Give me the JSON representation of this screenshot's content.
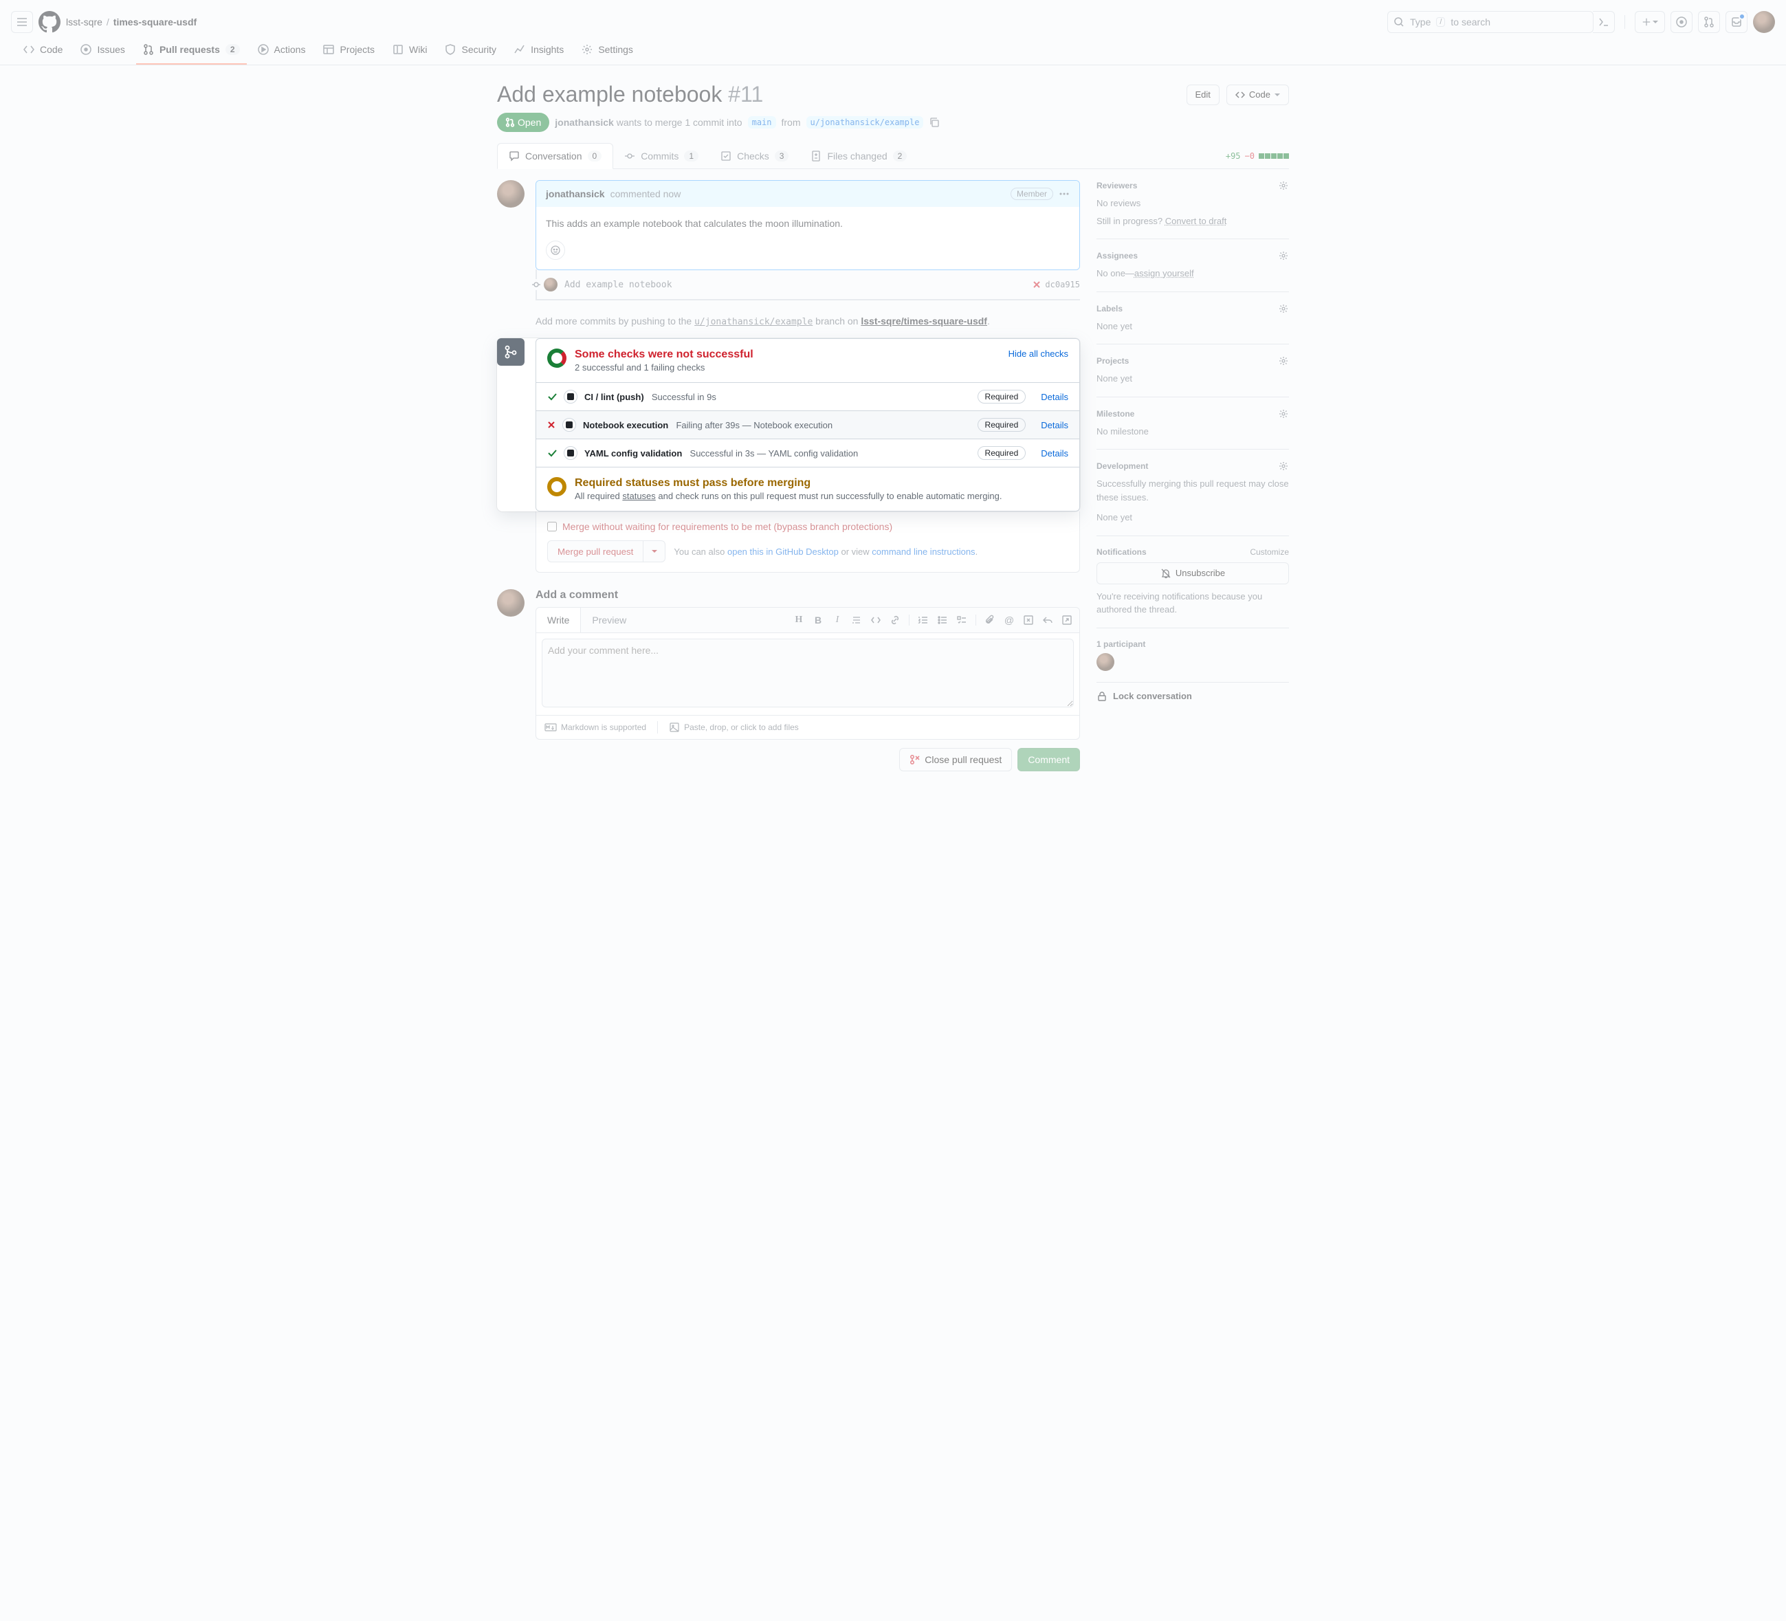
{
  "breadcrumb": {
    "owner": "lsst-sqre",
    "repo": "times-square-usdf"
  },
  "search": {
    "pre": "Type ",
    "post": " to search",
    "key": "/"
  },
  "reponav": {
    "code": "Code",
    "issues": "Issues",
    "pulls": "Pull requests",
    "pulls_count": "2",
    "actions": "Actions",
    "projects": "Projects",
    "wiki": "Wiki",
    "security": "Security",
    "insights": "Insights",
    "settings": "Settings"
  },
  "pr": {
    "title": "Add example notebook",
    "number": "#11",
    "edit": "Edit",
    "code": "Code",
    "state": "Open",
    "author": "jonathansick",
    "sub1": "wants to merge 1 commit into",
    "base": "main",
    "sub2": "from",
    "head": "u/jonathansick/example",
    "diff_add": "+95",
    "diff_del": "−0"
  },
  "tabs": {
    "conv": "Conversation",
    "conv_n": "0",
    "commits": "Commits",
    "commits_n": "1",
    "checks": "Checks",
    "checks_n": "3",
    "files": "Files changed",
    "files_n": "2"
  },
  "comment": {
    "author": "jonathansick",
    "meta": "commented now",
    "badge": "Member",
    "body": "This adds an example notebook that calculates the moon illumination."
  },
  "commit": {
    "msg": "Add example notebook",
    "sha": "dc0a915"
  },
  "push_hint": {
    "pre": "Add more commits by pushing to the ",
    "branch": "u/jonathansick/example",
    "mid": " branch on ",
    "repo": "lsst-sqre/times-square-usdf",
    "end": "."
  },
  "checks": {
    "hdr": "Some checks were not successful",
    "sub": "2 successful and 1 failing checks",
    "hide": "Hide all checks",
    "rows": [
      {
        "status": "ok",
        "name": "CI / lint (push)",
        "meta": "Successful in 9s",
        "required": true
      },
      {
        "status": "fail",
        "name": "Notebook execution",
        "meta": "Failing after 39s — Notebook execution",
        "required": true
      },
      {
        "status": "ok",
        "name": "YAML config validation",
        "meta": "Successful in 3s — YAML config validation",
        "required": true
      }
    ],
    "required": "Required",
    "details": "Details"
  },
  "req": {
    "hdr": "Required statuses must pass before merging",
    "pre": "All required ",
    "link": "statuses",
    "post": " and check runs on this pull request must run successfully to enable automatic merging."
  },
  "merge": {
    "bypass": "Merge without waiting for requirements to be met (bypass branch protections)",
    "btn": "Merge pull request",
    "hint1": "You can also ",
    "link1": "open this in GitHub Desktop",
    "hint2": " or view ",
    "link2": "command line instructions",
    "hint3": "."
  },
  "cform": {
    "title": "Add a comment",
    "write": "Write",
    "preview": "Preview",
    "placeholder": "Add your comment here...",
    "md": "Markdown is supported",
    "paste": "Paste, drop, or click to add files",
    "close": "Close pull request",
    "comment": "Comment"
  },
  "sidebar": {
    "reviewers": {
      "h": "Reviewers",
      "t1": "No reviews",
      "t2": "Still in progress? ",
      "link": "Convert to draft"
    },
    "assignees": {
      "h": "Assignees",
      "t": "No one—",
      "link": "assign yourself"
    },
    "labels": {
      "h": "Labels",
      "t": "None yet"
    },
    "projects": {
      "h": "Projects",
      "t": "None yet"
    },
    "milestone": {
      "h": "Milestone",
      "t": "No milestone"
    },
    "dev": {
      "h": "Development",
      "t1": "Successfully merging this pull request may close these issues.",
      "t2": "None yet"
    },
    "notif": {
      "h": "Notifications",
      "cust": "Customize",
      "btn": "Unsubscribe",
      "t": "You're receiving notifications because you authored the thread."
    },
    "part": {
      "h": "1 participant"
    },
    "lock": "Lock conversation"
  }
}
